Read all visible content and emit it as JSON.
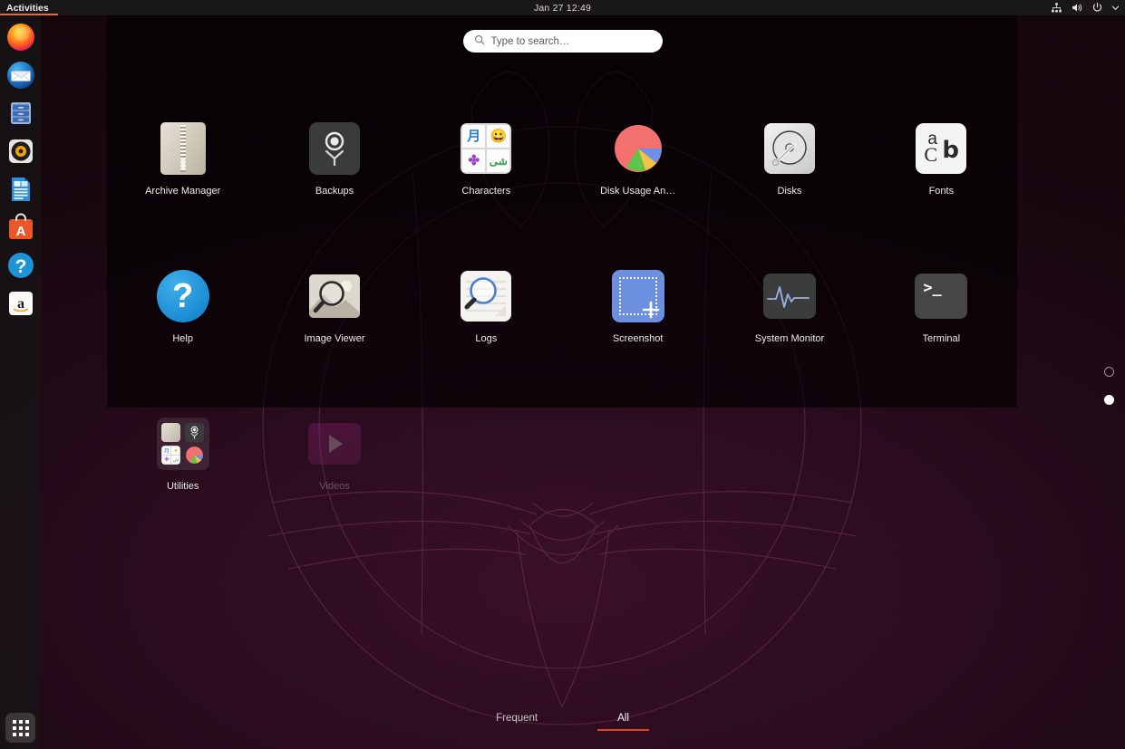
{
  "topbar": {
    "activities_label": "Activities",
    "clock": "Jan 27  12:49",
    "indicators": [
      {
        "name": "network-icon"
      },
      {
        "name": "volume-icon"
      },
      {
        "name": "power-icon"
      },
      {
        "name": "chevron-down-icon"
      }
    ]
  },
  "search": {
    "placeholder": "Type to search…",
    "value": "",
    "icon": "search-icon"
  },
  "dock": {
    "items": [
      {
        "name": "firefox",
        "label": "Firefox"
      },
      {
        "name": "thunderbird",
        "label": "Thunderbird Mail"
      },
      {
        "name": "files",
        "label": "Files"
      },
      {
        "name": "rhythmbox",
        "label": "Rhythmbox"
      },
      {
        "name": "libreoffice-writer",
        "label": "LibreOffice Writer"
      },
      {
        "name": "ubuntu-software",
        "label": "Ubuntu Software"
      },
      {
        "name": "help",
        "label": "Help"
      },
      {
        "name": "amazon",
        "label": "Amazon"
      }
    ],
    "show_apps_label": "Show Applications"
  },
  "grid": {
    "apps": [
      {
        "label": "Archive Manager",
        "icon": "archive-manager-icon",
        "dim": false
      },
      {
        "label": "Backups",
        "icon": "backups-icon",
        "dim": false
      },
      {
        "label": "Characters",
        "icon": "characters-icon",
        "dim": false,
        "glyphs": [
          "月",
          "😀",
          "✤",
          "شى"
        ]
      },
      {
        "label": "Disk Usage An…",
        "icon": "disk-usage-analyzer-icon",
        "dim": false
      },
      {
        "label": "Disks",
        "icon": "disks-icon",
        "dim": false
      },
      {
        "label": "Fonts",
        "icon": "fonts-icon",
        "dim": false,
        "glyphs": [
          "a",
          "C",
          "b"
        ]
      },
      {
        "label": "Help",
        "icon": "help-icon",
        "dim": false,
        "glyph": "?"
      },
      {
        "label": "Image Viewer",
        "icon": "image-viewer-icon",
        "dim": false
      },
      {
        "label": "Logs",
        "icon": "logs-icon",
        "dim": false
      },
      {
        "label": "Screenshot",
        "icon": "screenshot-icon",
        "dim": false
      },
      {
        "label": "System Monitor",
        "icon": "system-monitor-icon",
        "dim": false
      },
      {
        "label": "Terminal",
        "icon": "terminal-icon",
        "dim": false,
        "glyph": ">_"
      },
      {
        "label": "Utilities",
        "icon": "utilities-folder-icon",
        "dim": false
      },
      {
        "label": "Videos",
        "icon": "videos-icon",
        "dim": true
      }
    ]
  },
  "pages": {
    "count": 2,
    "current": 2
  },
  "tabs": [
    {
      "label": "Frequent",
      "active": false
    },
    {
      "label": "All",
      "active": true
    }
  ],
  "colors": {
    "accent": "#dd4814",
    "topbar_bg": "#1a1719",
    "panel_overlay": "rgba(0,0,0,0.62)",
    "wallpaper_base": "#2a0c1e"
  }
}
